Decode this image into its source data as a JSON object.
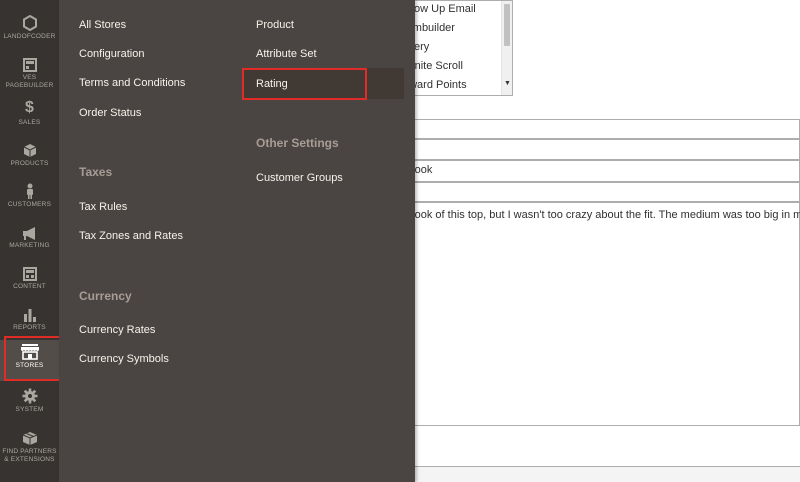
{
  "sidebar": {
    "items": [
      {
        "label": "LANDOFCODER",
        "icon": "hexagon-icon"
      },
      {
        "label": "VES PAGEBUILDER",
        "icon": "layout-icon"
      },
      {
        "label": "SALES",
        "icon": "dollar-icon"
      },
      {
        "label": "PRODUCTS",
        "icon": "cube-icon"
      },
      {
        "label": "CUSTOMERS",
        "icon": "person-icon"
      },
      {
        "label": "MARKETING",
        "icon": "megaphone-icon"
      },
      {
        "label": "CONTENT",
        "icon": "layout-icon"
      },
      {
        "label": "REPORTS",
        "icon": "bar-chart-icon"
      },
      {
        "label": "STORES",
        "icon": "store-icon"
      },
      {
        "label": "SYSTEM",
        "icon": "gear-icon"
      },
      {
        "label": "FIND PARTNERS & EXTENSIONS",
        "icon": "box-icon"
      }
    ],
    "active_item": "STORES",
    "highlight_color": "#e02b27"
  },
  "flyout": {
    "settings": {
      "all_stores": "All Stores",
      "configuration": "Configuration",
      "terms": "Terms and Conditions",
      "order_status": "Order Status"
    },
    "taxes": {
      "heading": "Taxes",
      "tax_rules": "Tax Rules",
      "tax_zones": "Tax Zones and Rates"
    },
    "currency": {
      "heading": "Currency",
      "rates": "Currency Rates",
      "symbols": "Currency Symbols"
    },
    "attributes": {
      "product": "Product",
      "attribute_set": "Attribute Set",
      "rating": "Rating"
    },
    "other_settings": {
      "heading": "Other Settings",
      "customer_groups": "Customer Groups"
    }
  },
  "background": {
    "multiselect_options": [
      "ollow Up Email",
      "ormbuilder",
      "allery",
      "nfinite Scroll",
      "eward Points"
    ],
    "summary_value": "e look",
    "review_value": "e look of this top, but I wasn't too crazy about the fit. The medium was too big in my opin"
  }
}
